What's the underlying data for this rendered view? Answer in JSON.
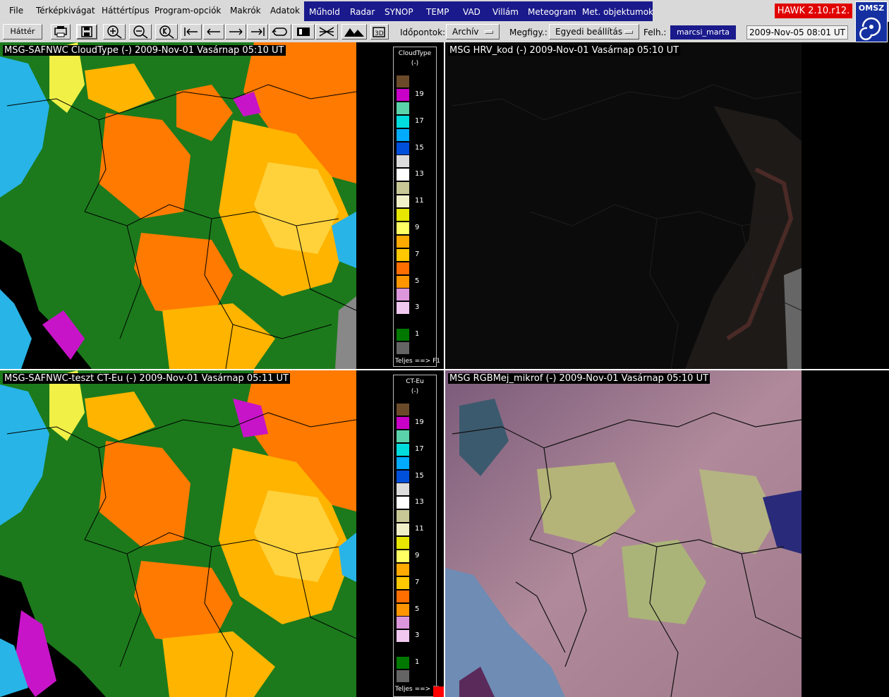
{
  "menubar": {
    "items": [
      "File",
      "Térképkivágat",
      "Háttértípus",
      "Program-opciók",
      "Makrók",
      "Adatok"
    ],
    "blue_items": [
      "Műhold",
      "Radar",
      "SYNOP",
      "TEMP",
      "VAD",
      "Villám",
      "Meteogram",
      "Met. objektumok"
    ],
    "version": "HAWK 2.10.r12.",
    "logo": "OMSZ"
  },
  "toolbar": {
    "background_button": "Háttér",
    "icons": [
      "print-icon",
      "save-icon",
      "zoom-in-icon",
      "zoom-out-icon",
      "zoom-reset-icon",
      "first-frame-icon",
      "prev-frame-icon",
      "next-frame-icon",
      "last-frame-icon",
      "loop-icon",
      "frame-icon",
      "cross-section-icon",
      "mountain-icon",
      "3d-icon"
    ],
    "times_label": "Időpontok:",
    "times_value": "Archív",
    "display_label": "Megfigy.:",
    "display_value": "Egyedi beállítás",
    "user_label": "Felh.:",
    "user_value": "marcsi_marta",
    "datetime": "2009-Nov-05 08:01 UT"
  },
  "panels": [
    {
      "title": "MSG-SAFNWC  CloudType (-)  2009-Nov-01 Vasárnap 05:10 UT"
    },
    {
      "title": "MSG  HRV_kod (-)  2009-Nov-01 Vasárnap 05:10 UT"
    },
    {
      "title": "MSG-SAFNWC-teszt  CT-Eu (-)  2009-Nov-01 Vasárnap 05:11 UT"
    },
    {
      "title": "MSG  RGBMej_mikrof (-)  2009-Nov-01 Vasárnap 05:10 UT"
    }
  ],
  "legends": [
    {
      "title": "CloudType",
      "unit": "(-)",
      "footer": "Teljes ==> F1"
    },
    {
      "title": "CT-Eu",
      "unit": "(-)",
      "footer": "Teljes ==> F1"
    }
  ],
  "legend_scale": {
    "colors": [
      "#6b4a2a",
      "#c800c8",
      "#5ad2aa",
      "#00dcdc",
      "#00aaff",
      "#0050dc",
      "#dcdcdc",
      "#ffffff",
      "#c8c896",
      "#f0f0c8",
      "#e6e600",
      "#ffff64",
      "#ffaa00",
      "#ffc800",
      "#ff6e00",
      "#ff9600",
      "#dc96dc",
      "#f0c8f0",
      "#000000",
      "#007800",
      "#646464"
    ],
    "labels": [
      "19",
      "17",
      "15",
      "13",
      "11",
      "9",
      "7",
      "5",
      "3",
      "1"
    ]
  },
  "colors": {
    "menu_blue": "#1a1a8c",
    "version_red": "#e00000",
    "land_green": "#1c7a1c",
    "cloud_orange": "#ff7a00",
    "cloud_amber": "#ffb400",
    "cloud_cyan": "#28b4e6",
    "cloud_magenta": "#c814c8"
  }
}
